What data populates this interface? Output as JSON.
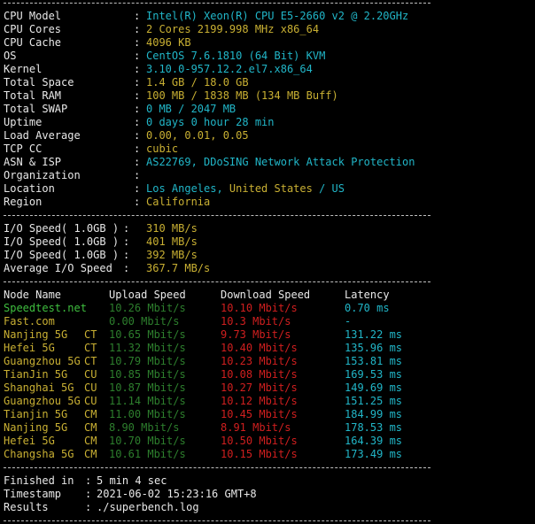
{
  "system": [
    {
      "label": "CPU Model",
      "value": "Intel(R) Xeon(R) CPU E5-2660 v2 @ 2.20GHz",
      "color": "#21b6c8"
    },
    {
      "label": "CPU Cores",
      "value": "2 Cores 2199.998 MHz x86_64",
      "color": "#c9b033"
    },
    {
      "label": "CPU Cache",
      "value": "4096 KB",
      "color": "#c9b033"
    },
    {
      "label": "OS",
      "value": "CentOS 7.6.1810 (64 Bit) KVM",
      "color": "#21b6c8"
    },
    {
      "label": "Kernel",
      "value": "3.10.0-957.12.2.el7.x86_64",
      "color": "#21b6c8"
    },
    {
      "label": "Total Space",
      "value": "1.4 GB / 18.0 GB",
      "color": "#c9b033"
    },
    {
      "label": "Total RAM",
      "value": "100 MB / 1838 MB (134 MB Buff)",
      "color": "#c9b033"
    },
    {
      "label": "Total SWAP",
      "value": "0 MB / 2047 MB",
      "color": "#21b6c8"
    },
    {
      "label": "Uptime",
      "value": "0 days 0 hour 28 min",
      "color": "#21b6c8"
    },
    {
      "label": "Load Average",
      "value": "0.00, 0.01, 0.05",
      "color": "#c9b033"
    },
    {
      "label": "TCP CC",
      "value": "cubic",
      "color": "#c9b033"
    },
    {
      "label": "ASN & ISP",
      "value": "AS22769, DDoSING Network Attack Protection",
      "color": "#21b6c8"
    },
    {
      "label": "Organization",
      "value": "",
      "color": "#21b6c8"
    },
    {
      "label": "Location",
      "value_parts": [
        {
          "text": "Los Angeles, ",
          "color": "#21b6c8"
        },
        {
          "text": "United States",
          "color": "#c9b033"
        },
        {
          "text": " / US",
          "color": "#21b6c8"
        }
      ]
    },
    {
      "label": "Region",
      "value": "California",
      "color": "#c9b033"
    }
  ],
  "io": [
    {
      "label": "I/O Speed( 1.0GB )",
      "value": "310 MB/s",
      "color": "#c9b033"
    },
    {
      "label": "I/O Speed( 1.0GB )",
      "value": "401 MB/s",
      "color": "#c9b033"
    },
    {
      "label": "I/O Speed( 1.0GB )",
      "value": "392 MB/s",
      "color": "#c9b033"
    },
    {
      "label": "Average I/O Speed",
      "value": "367.7 MB/s",
      "color": "#c9b033"
    }
  ],
  "speed_header": {
    "node": "Node Name",
    "upload": "Upload Speed",
    "download": "Download Speed",
    "latency": "Latency"
  },
  "speed": [
    {
      "node": "Speedtest.net",
      "isp": "",
      "upload": "10.26 Mbit/s",
      "download": "10.10 Mbit/s",
      "latency": "0.70 ms",
      "node_color": "#c9b033"
    },
    {
      "node": "Fast.com",
      "isp": "",
      "upload": "0.00 Mbit/s",
      "download": "10.3 Mbit/s",
      "latency": "-",
      "node_color": "#c9b033"
    },
    {
      "node": "Nanjing 5G",
      "isp": "CT",
      "upload": "10.65 Mbit/s",
      "download": "9.73 Mbit/s",
      "latency": "131.22 ms",
      "node_color": "#c9b033"
    },
    {
      "node": "Hefei 5G",
      "isp": "CT",
      "upload": "11.32 Mbit/s",
      "download": "10.40 Mbit/s",
      "latency": "135.96 ms",
      "node_color": "#c9b033"
    },
    {
      "node": "Guangzhou 5G",
      "isp": "CT",
      "upload": "10.79 Mbit/s",
      "download": "10.23 Mbit/s",
      "latency": "153.81 ms",
      "node_color": "#c9b033"
    },
    {
      "node": "TianJin 5G",
      "isp": "CU",
      "upload": "10.85 Mbit/s",
      "download": "10.08 Mbit/s",
      "latency": "169.53 ms",
      "node_color": "#c9b033"
    },
    {
      "node": "Shanghai 5G",
      "isp": "CU",
      "upload": "10.87 Mbit/s",
      "download": "10.27 Mbit/s",
      "latency": "149.69 ms",
      "node_color": "#c9b033"
    },
    {
      "node": "Guangzhou 5G",
      "isp": "CU",
      "upload": "11.14 Mbit/s",
      "download": "10.12 Mbit/s",
      "latency": "151.25 ms",
      "node_color": "#c9b033"
    },
    {
      "node": "Tianjin 5G",
      "isp": "CM",
      "upload": "11.00 Mbit/s",
      "download": "10.45 Mbit/s",
      "latency": "184.99 ms",
      "node_color": "#c9b033"
    },
    {
      "node": "Nanjing 5G",
      "isp": "CM",
      "upload": "8.90 Mbit/s",
      "download": "8.91 Mbit/s",
      "latency": "178.53 ms",
      "node_color": "#c9b033"
    },
    {
      "node": "Hefei 5G",
      "isp": "CM",
      "upload": "10.70 Mbit/s",
      "download": "10.50 Mbit/s",
      "latency": "164.39 ms",
      "node_color": "#c9b033"
    },
    {
      "node": "Changsha 5G",
      "isp": "CM",
      "upload": "10.61 Mbit/s",
      "download": "10.15 Mbit/s",
      "latency": "173.49 ms",
      "node_color": "#c9b033"
    }
  ],
  "footer": [
    {
      "label": "Finished in",
      "value": "5 min 4 sec"
    },
    {
      "label": "Timestamp",
      "value": "2021-06-02 15:23:16 GMT+8"
    },
    {
      "label": "Results",
      "value": "./superbench.log"
    }
  ],
  "colors": {
    "background": "#000000",
    "label": "#e8e8e8",
    "cyan": "#21b6c8",
    "yellow": "#c9b033",
    "upload": "#2d7f2d",
    "download": "#d11f1f",
    "latency": "#21b6c8",
    "first_node": "#3fbf3f"
  }
}
